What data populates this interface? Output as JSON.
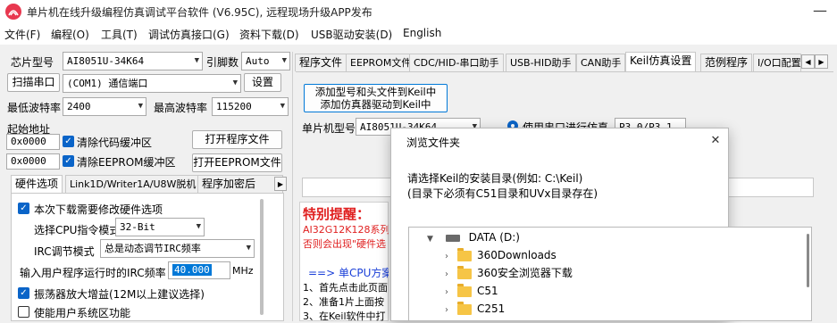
{
  "window": {
    "title": "单片机在线升级编程仿真调试平台软件 (V6.95C), 远程现场升级APP发布",
    "minimize_glyph": "—"
  },
  "menu": [
    "文件(F)",
    "编程(O)",
    "工具(T)",
    "调试仿真接口(G)",
    "资料下载(D)",
    "USB驱动安装(D)",
    "English"
  ],
  "left": {
    "chip_label": "芯片型号",
    "chip_value": "AI8051U-34K64",
    "pin_label": "引脚数",
    "pin_value": "Auto",
    "scan_button": "扫描串口",
    "port_value": "(COM1) 通信端口",
    "settings_button": "设置",
    "min_baud_label": "最低波特率",
    "min_baud_value": "2400",
    "max_baud_label": "最高波特率",
    "max_baud_value": "115200",
    "start_addr_label": "起始地址",
    "addr1": "0x0000",
    "clear_code_label": "清除代码缓冲区",
    "open_program_button": "打开程序文件",
    "addr2": "0x0000",
    "clear_eeprom_label": "清除EEPROM缓冲区",
    "open_eeprom_button": "打开EEPROM文件",
    "tabs": [
      "硬件选项",
      "Link1D/Writer1A/U8W脱机",
      "程序加密后"
    ],
    "opt_modify_hw": "本次下载需要修改硬件选项",
    "cpu_mode_label": "选择CPU指令模式",
    "cpu_mode_value": "32-Bit",
    "irc_mode_label": "IRC调节模式",
    "irc_mode_value": "总是动态调节IRC频率",
    "irc_freq_label": "输入用户程序运行时的IRC频率",
    "irc_freq_value": "40.000",
    "irc_freq_unit": "MHz",
    "osc_gain_label": "振荡器放大增益(12M以上建议选择)",
    "sys_reset_label": "使能用户系统区功能"
  },
  "right": {
    "tabs": [
      "程序文件",
      "EEPROM文件",
      "CDC/HID-串口助手",
      "USB-HID助手",
      "CAN助手",
      "Keil仿真设置",
      "范例程序",
      "I/O口配置"
    ],
    "add_keil_button_line1": "添加型号和头文件到Keil中",
    "add_keil_button_line2": "添加仿真器驱动到Keil中",
    "mcu_model_label": "单片机型号",
    "mcu_model_value": "AI8051U-34K64",
    "use_uart_label": "使用串口进行仿真",
    "uart_pins_value": "P3.0/P3.1",
    "warning_title": "特别提醒：",
    "warning_line1": "AI32G12K128系列芯",
    "warning_line2": "否则会出现\"硬件选",
    "single_cpu_line": "==> 单CPU方案仿真",
    "step1": "1、首先点击此页面",
    "step2": "2、准备1片上面按",
    "step3": "3、在Keil软件中打"
  },
  "dialog": {
    "title": "浏览文件夹",
    "close_glyph": "✕",
    "prompt_line1": "请选择Keil的安装目录(例如: C:\\Keil)",
    "prompt_line2": "(目录下必须有C51目录和UVx目录存在)",
    "drive_label": "DATA (D:)",
    "folders": [
      "360Downloads",
      "360安全浏览器下载",
      "C51",
      "C251"
    ]
  },
  "colors": {
    "accent": "#0a64c8",
    "warning": "#e02020",
    "folder": "#f6c546",
    "selection": "#0078d7"
  }
}
